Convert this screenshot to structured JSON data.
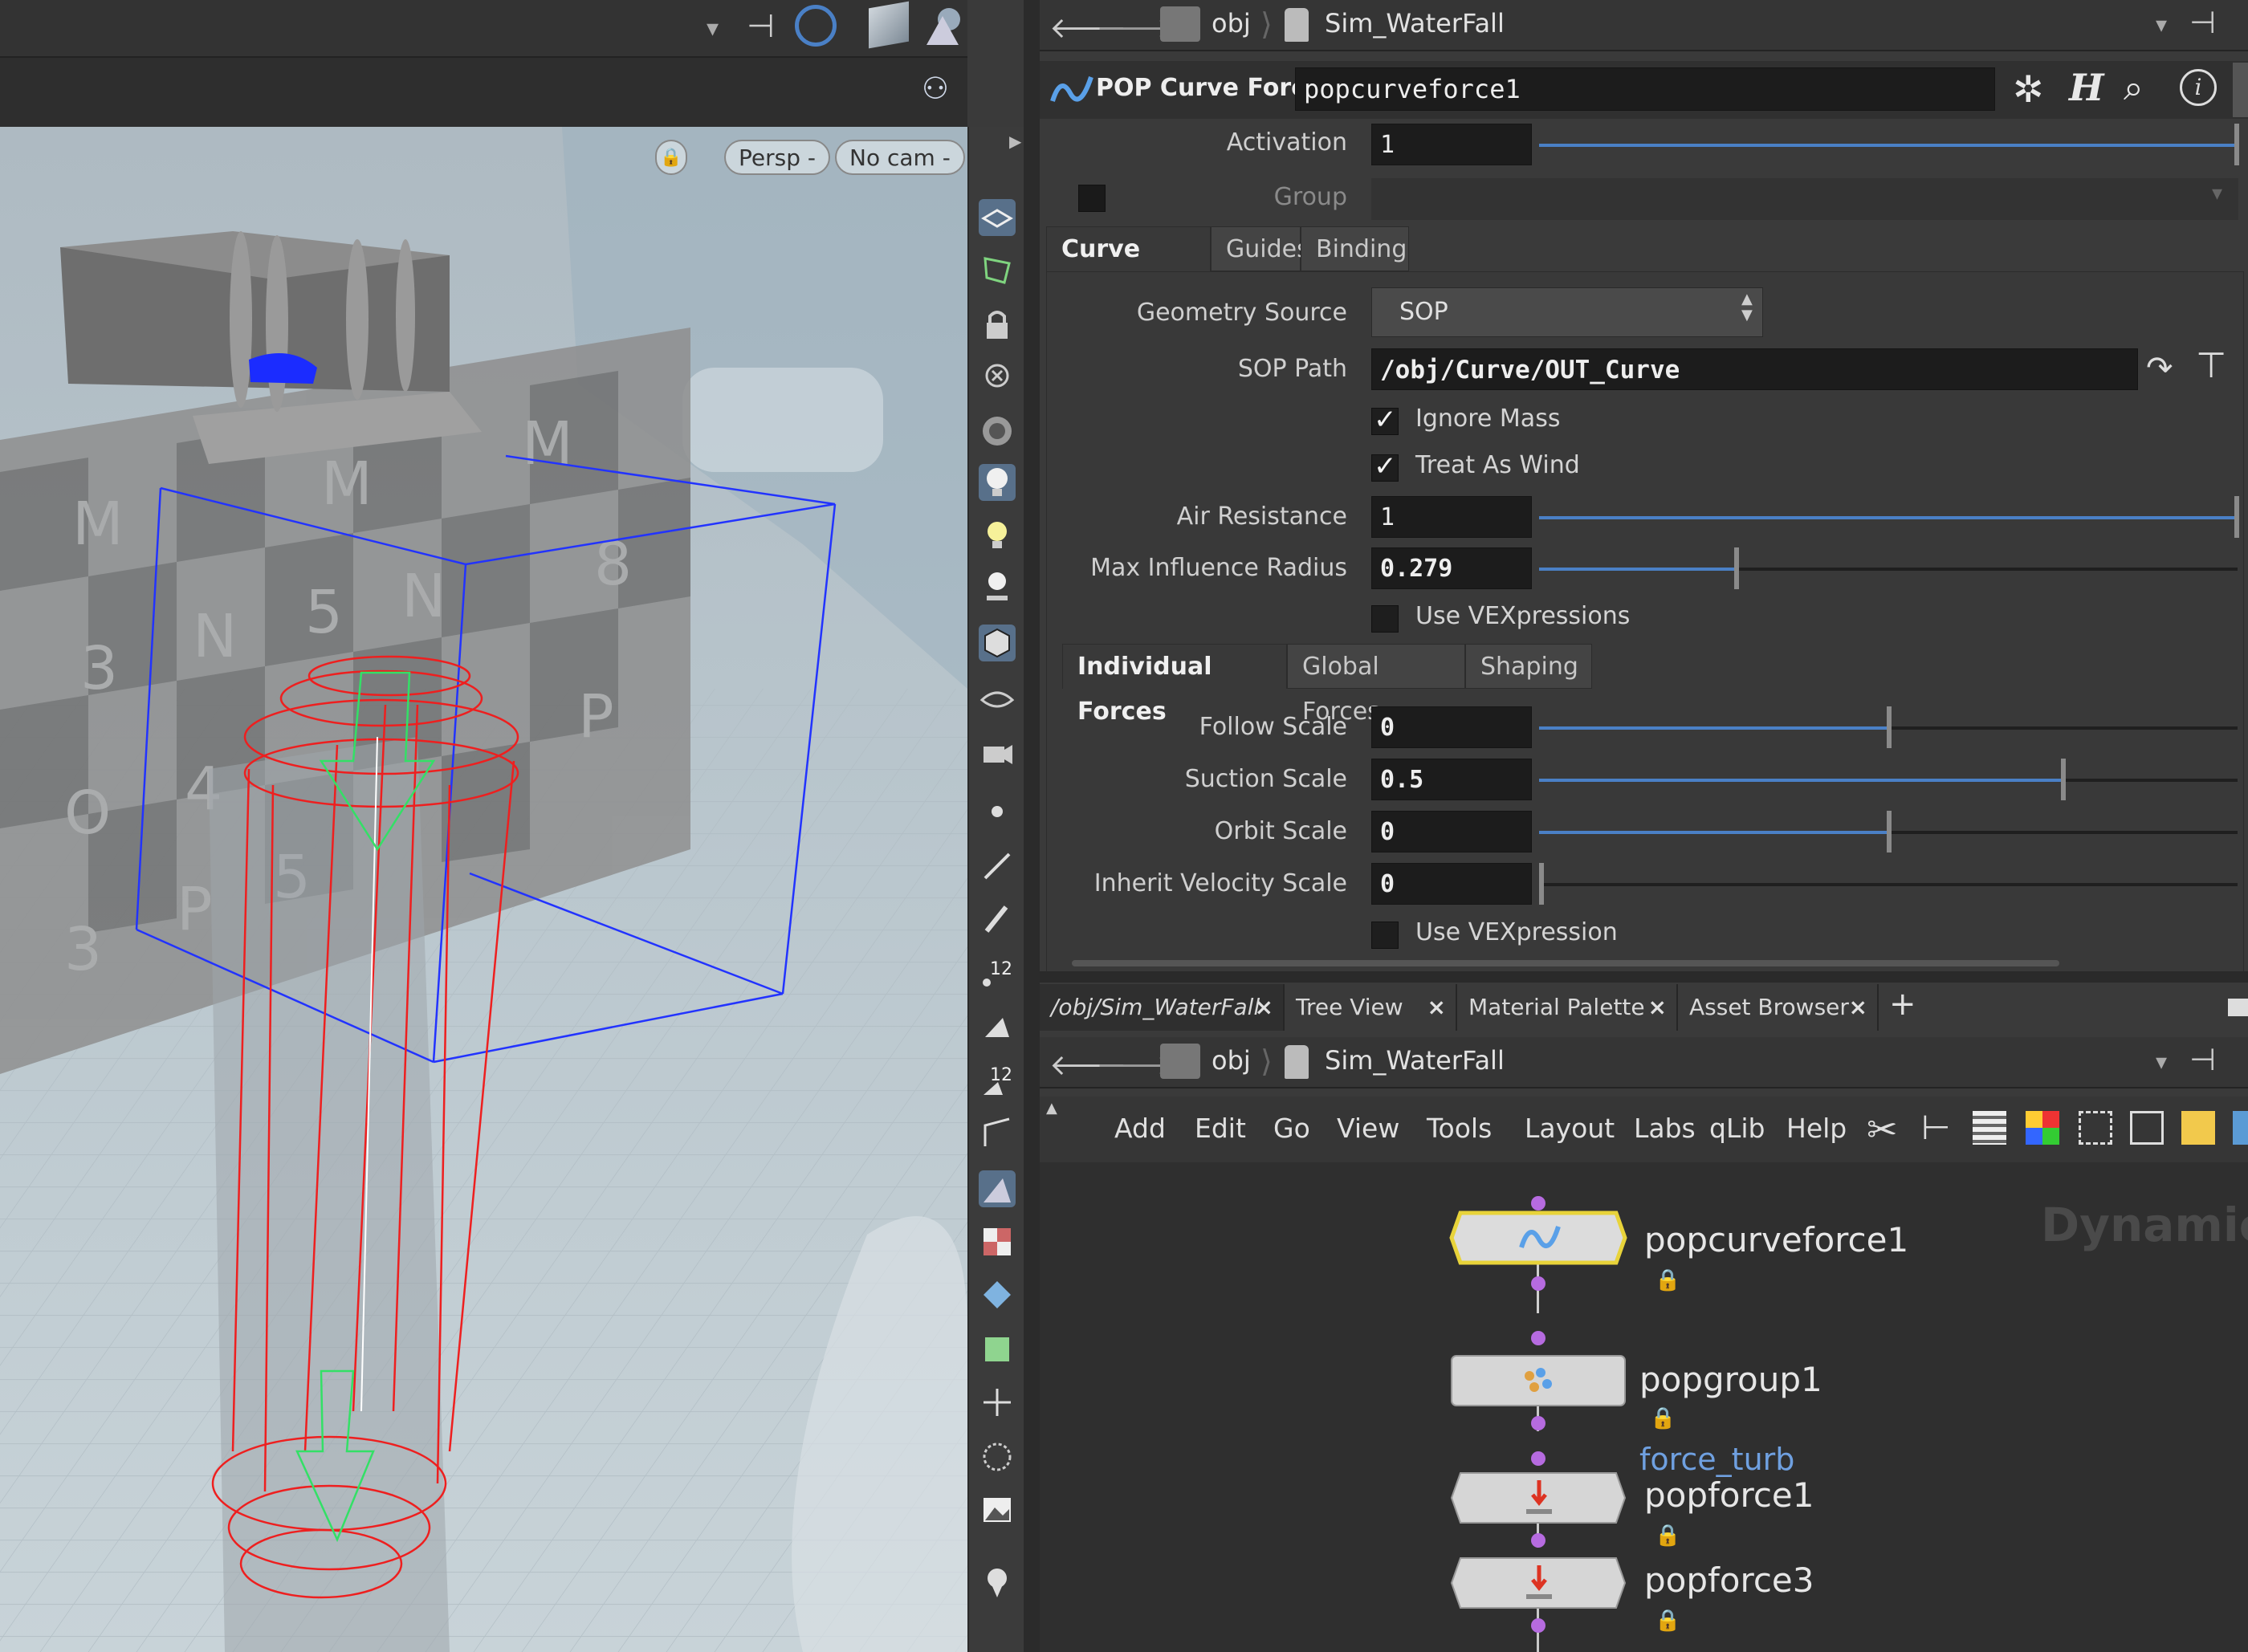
{
  "viewport": {
    "lock_label": "🔒",
    "persp_label": "Persp -",
    "cam_label": "No cam -"
  },
  "path_top": {
    "root": "obj",
    "node": "Sim_WaterFall"
  },
  "param": {
    "node_type": "POP Curve Force",
    "node_name": "popcurveforce1",
    "activation_label": "Activation",
    "activation_value": "1",
    "group_label": "Group",
    "tabs": [
      "Curve Force",
      "Guides",
      "Binding"
    ],
    "geometry_source_label": "Geometry Source",
    "geometry_source_value": "SOP",
    "sop_path_label": "SOP Path",
    "sop_path_value": "/obj/Curve/OUT_Curve",
    "ignore_mass_label": "Ignore Mass",
    "treat_as_wind_label": "Treat As Wind",
    "air_resistance_label": "Air Resistance",
    "air_resistance_value": "1",
    "max_radius_label": "Max Influence Radius",
    "max_radius_value": "0.279",
    "use_vexpressions_label": "Use VEXpressions",
    "subtabs": [
      "Individual Forces",
      "Global Forces",
      "Shaping"
    ],
    "follow_scale_label": "Follow Scale",
    "follow_scale_value": "0",
    "suction_scale_label": "Suction Scale",
    "suction_scale_value": "0.5",
    "orbit_scale_label": "Orbit Scale",
    "orbit_scale_value": "0",
    "inherit_velocity_label": "Inherit Velocity Scale",
    "inherit_velocity_value": "0",
    "use_vexpression_label": "Use VEXpression"
  },
  "pane_tabs": [
    "/obj/Sim_WaterFall",
    "Tree View",
    "Material Palette",
    "Asset Browser"
  ],
  "path_bottom": {
    "root": "obj",
    "node": "Sim_WaterFall"
  },
  "menu": [
    "Add",
    "Edit",
    "Go",
    "View",
    "Tools",
    "Layout",
    "Labs",
    "qLib",
    "Help"
  ],
  "network": {
    "watermark": "Dynamic",
    "nodes": [
      {
        "name": "popcurveforce1",
        "comment": ""
      },
      {
        "name": "popgroup1",
        "comment": ""
      },
      {
        "name": "popforce1",
        "comment": "force_turb"
      },
      {
        "name": "popforce3",
        "comment": ""
      }
    ]
  },
  "colors": {
    "accent_blue": "#4a80c6",
    "node_selected": "#e8d33a",
    "connector": "#b66be0",
    "comment": "#6fa0e0"
  }
}
